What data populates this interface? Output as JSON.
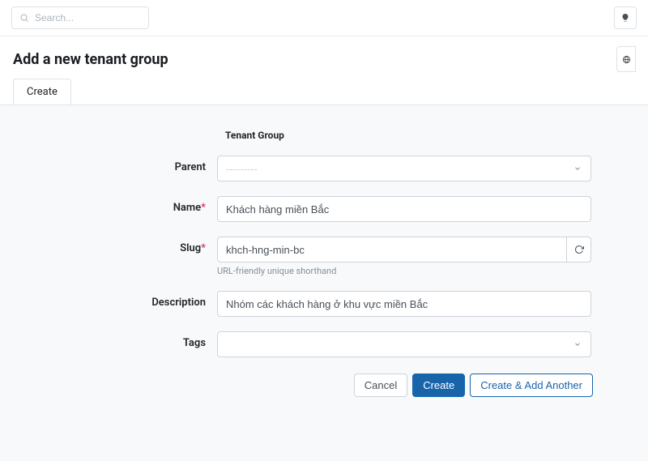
{
  "search": {
    "placeholder": "Search..."
  },
  "page_title": "Add a new tenant group",
  "tabs": {
    "create": "Create"
  },
  "section_heading": "Tenant Group",
  "fields": {
    "parent": {
      "label": "Parent",
      "placeholder": "---------"
    },
    "name": {
      "label": "Name",
      "value": "Khách hàng miền Bắc"
    },
    "slug": {
      "label": "Slug",
      "value": "khch-hng-min-bc",
      "help": "URL-friendly unique shorthand"
    },
    "description": {
      "label": "Description",
      "value": "Nhóm các khách hàng ở khu vực miền Bắc"
    },
    "tags": {
      "label": "Tags",
      "placeholder": ""
    }
  },
  "buttons": {
    "cancel": "Cancel",
    "create": "Create",
    "create_another": "Create & Add Another"
  }
}
